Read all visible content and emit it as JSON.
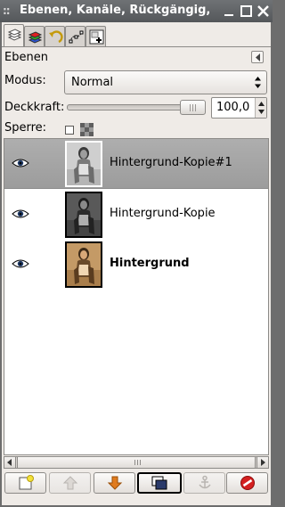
{
  "window": {
    "title": "Ebenen, Kanäle, Rückgängig,",
    "grip": "::"
  },
  "tabs": [
    {
      "name": "layers-tab",
      "icon": "layers-icon",
      "active": true
    },
    {
      "name": "channels-tab",
      "icon": "channels-icon",
      "active": false
    },
    {
      "name": "undo-tab",
      "icon": "undo-history-icon",
      "active": false
    },
    {
      "name": "paths-tab",
      "icon": "paths-icon",
      "active": false
    },
    {
      "name": "navigation-tab",
      "icon": "navigation-icon",
      "active": false
    }
  ],
  "panel": {
    "title": "Ebenen"
  },
  "mode": {
    "label": "Modus:",
    "value": "Normal"
  },
  "opacity": {
    "label": "Deckkraft:",
    "value": "100,0",
    "level_percent": 100
  },
  "lock": {
    "label": "Sperre:"
  },
  "layers": [
    {
      "name": "Hintergrund-Kopie#1",
      "visible": true,
      "selected": true,
      "bold": false,
      "thumb_style": "grayscale-light"
    },
    {
      "name": "Hintergrund-Kopie",
      "visible": true,
      "selected": false,
      "bold": false,
      "thumb_style": "grayscale-dark"
    },
    {
      "name": "Hintergrund",
      "visible": true,
      "selected": false,
      "bold": true,
      "thumb_style": "sepia"
    }
  ],
  "buttons": [
    {
      "name": "new-layer-button",
      "icon": "new-layer-icon",
      "enabled": true
    },
    {
      "name": "raise-layer-button",
      "icon": "arrow-up-icon",
      "enabled": false
    },
    {
      "name": "lower-layer-button",
      "icon": "arrow-down-icon",
      "enabled": true
    },
    {
      "name": "duplicate-layer-button",
      "icon": "duplicate-icon",
      "enabled": true
    },
    {
      "name": "anchor-layer-button",
      "icon": "anchor-icon",
      "enabled": false
    },
    {
      "name": "delete-layer-button",
      "icon": "delete-icon",
      "enabled": true
    }
  ],
  "colors": {
    "titlebar": "#5f6265",
    "selected_row": "#a4a4a4",
    "accent_orange": "#e07b1e",
    "delete_red": "#d42020"
  }
}
